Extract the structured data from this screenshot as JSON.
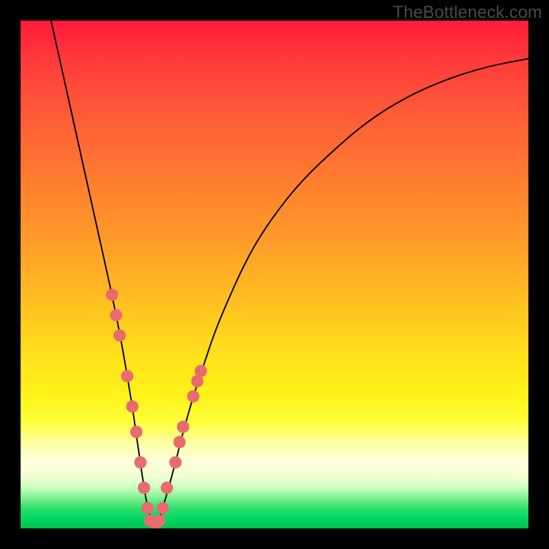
{
  "watermark": "TheBottleneck.com",
  "chart_data": {
    "type": "line",
    "title": "",
    "xlabel": "",
    "ylabel": "",
    "xlim": [
      0,
      100
    ],
    "ylim": [
      0,
      100
    ],
    "grid": false,
    "legend": "none",
    "series": [
      {
        "name": "bottleneck-curve",
        "x": [
          6,
          8,
          10,
          12,
          14,
          16,
          18,
          20,
          22,
          23,
          24,
          25,
          26,
          27,
          28,
          30,
          32,
          34,
          36,
          38,
          40,
          44,
          48,
          54,
          60,
          68,
          76,
          84,
          92,
          100
        ],
        "y": [
          100,
          91,
          82,
          73,
          64,
          55,
          46,
          36,
          24,
          17,
          10,
          4,
          1,
          1,
          4,
          11,
          19,
          26,
          32,
          38,
          43,
          52,
          59,
          67,
          73,
          80,
          85,
          88.5,
          91,
          92.5
        ]
      }
    ],
    "curve_minimum_x": 26,
    "markers": {
      "name": "highlighted-points",
      "left_arm": [
        {
          "x": 18,
          "y": 46
        },
        {
          "x": 18.8,
          "y": 42
        },
        {
          "x": 19.5,
          "y": 38
        },
        {
          "x": 21,
          "y": 30
        },
        {
          "x": 22,
          "y": 24
        },
        {
          "x": 22.8,
          "y": 19
        },
        {
          "x": 23.6,
          "y": 13
        },
        {
          "x": 24.3,
          "y": 8
        },
        {
          "x": 25,
          "y": 4
        }
      ],
      "right_arm": [
        {
          "x": 28,
          "y": 4
        },
        {
          "x": 28.8,
          "y": 8
        },
        {
          "x": 30.5,
          "y": 13
        },
        {
          "x": 31.3,
          "y": 17
        },
        {
          "x": 32,
          "y": 20
        },
        {
          "x": 34,
          "y": 26
        },
        {
          "x": 34.8,
          "y": 29
        },
        {
          "x": 35.5,
          "y": 31
        }
      ],
      "minimum": [
        {
          "x": 25.5,
          "y": 1.5
        },
        {
          "x": 26.5,
          "y": 1
        },
        {
          "x": 27.3,
          "y": 1.5
        }
      ]
    },
    "colors": {
      "curve": "#000000",
      "markers": "#e96a6f",
      "background_top": "#ff1a3c",
      "background_bottom": "#00c050"
    }
  }
}
